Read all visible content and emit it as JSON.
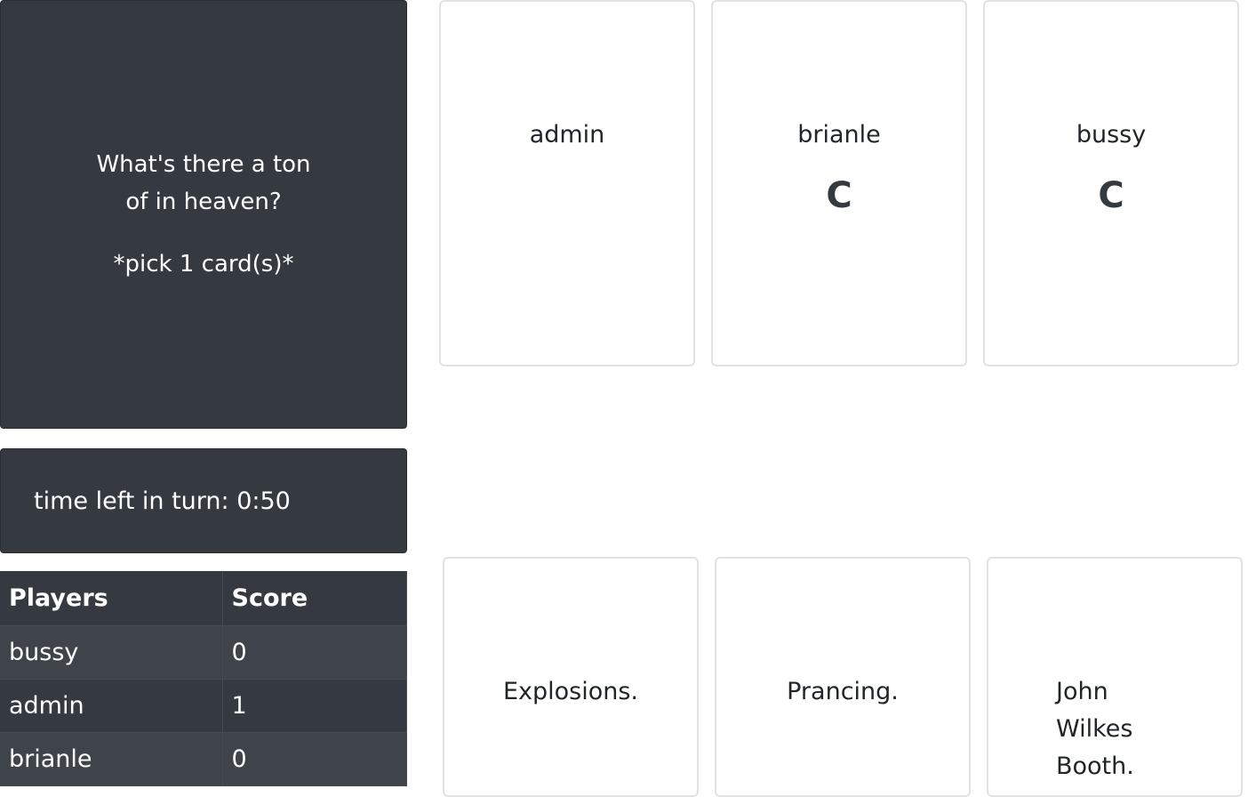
{
  "black_card": {
    "question": "What's there a ton of in heaven?",
    "pick_note": "*pick 1 card(s)*"
  },
  "timer": {
    "text": "time left in turn: 0:50"
  },
  "scoreboard": {
    "headers": [
      "Players",
      "Score"
    ],
    "rows": [
      {
        "player": "bussy",
        "score": "0"
      },
      {
        "player": "admin",
        "score": "1"
      },
      {
        "player": "brianle",
        "score": "0"
      }
    ]
  },
  "submissions": [
    {
      "player": "admin",
      "badge": ""
    },
    {
      "player": "brianle",
      "badge": "C"
    },
    {
      "player": "bussy",
      "badge": "C"
    }
  ],
  "hand": [
    {
      "text": "Explosions."
    },
    {
      "text": "Prancing."
    },
    {
      "text": "John Wilkes Booth."
    }
  ]
}
